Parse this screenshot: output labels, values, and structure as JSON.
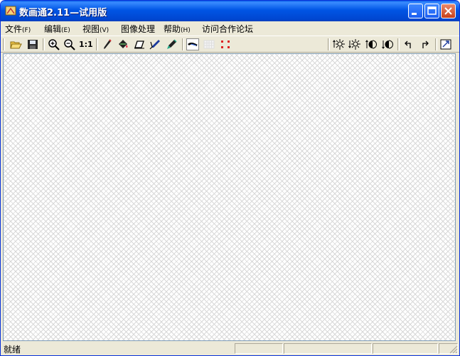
{
  "window": {
    "title": "数画通2.11—试用版"
  },
  "menu": {
    "items": [
      {
        "label": "文件",
        "accel": "(F)"
      },
      {
        "label": "编辑",
        "accel": "(E)"
      },
      {
        "label": "视图",
        "accel": "(V)"
      },
      {
        "label": "图像处理",
        "accel": ""
      },
      {
        "label": "帮助",
        "accel": "(H)"
      },
      {
        "label": "访问合作论坛",
        "accel": ""
      }
    ]
  },
  "toolbar": {
    "zoom_actual_label": "1:1",
    "icons": [
      "open-folder-icon",
      "save-icon",
      "zoom-in-icon",
      "zoom-out-icon",
      "actual-size-icon",
      "pencil-icon",
      "fill-icon",
      "eraser-icon",
      "pen-icon",
      "marker-icon",
      "brush-icon",
      "grid-icon",
      "dots-icon",
      "expand-horizontal-icon",
      "shrink-horizontal-icon",
      "expand-vertical-icon",
      "shrink-vertical-icon",
      "undo-icon",
      "redo-icon",
      "fit-window-icon"
    ]
  },
  "status": {
    "text": "就绪"
  },
  "colors": {
    "titlebar": "#0055e5",
    "chrome": "#ece9d8",
    "close": "#c8401b"
  }
}
